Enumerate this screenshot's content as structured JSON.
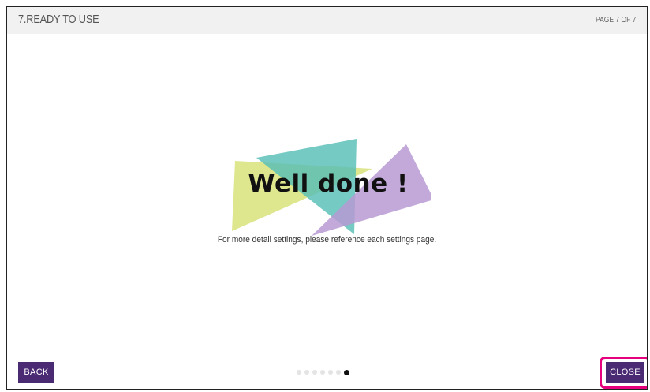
{
  "header": {
    "title": "7.READY TO USE",
    "page_indicator": "PAGE 7 OF 7"
  },
  "main": {
    "headline": "Well done !",
    "subtitle": "For more detail settings, please reference each settings page."
  },
  "footer": {
    "back_label": "BACK",
    "close_label": "CLOSE",
    "pagination": {
      "total": 7,
      "current": 7
    }
  },
  "colors": {
    "button": "#4a2a73",
    "highlight": "#e6007e",
    "triangle_yellow": "#d8e27a",
    "triangle_teal": "#52bdb5",
    "triangle_purple": "#b79ad3"
  }
}
